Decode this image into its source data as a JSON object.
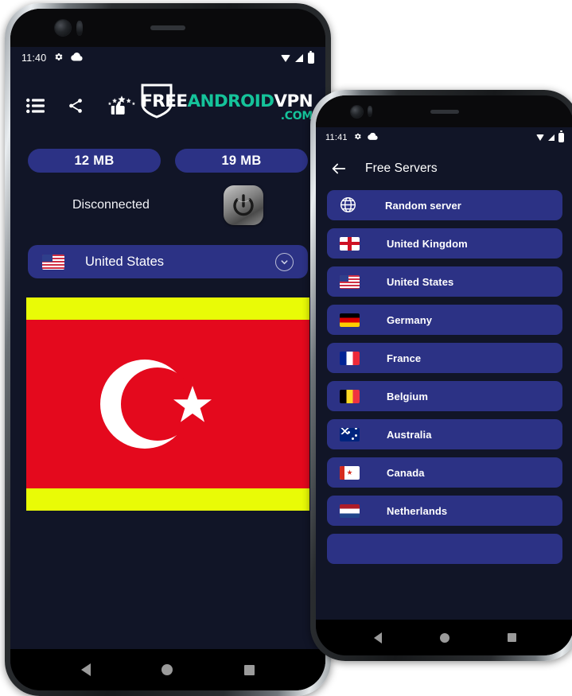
{
  "phone1": {
    "status_bar": {
      "time": "11:40",
      "left_icons": [
        "gear-icon",
        "cloud-icon"
      ],
      "right_icons": [
        "wifi-icon",
        "signal-icon",
        "battery-icon"
      ]
    },
    "toolbar": {
      "icons": [
        "menu-list-icon",
        "share-icon",
        "rate-us-icon"
      ],
      "logo": {
        "part_white_1": "FREE",
        "part_teal": "ANDROID",
        "part_white_2": "VPN",
        "domain": ".COM",
        "teal_color": "#15c39a",
        "shield": "shield-icon"
      }
    },
    "stats": {
      "download_label": "12 MB",
      "upload_label": "19 MB"
    },
    "connection": {
      "status_text": "Disconnected",
      "power_button": "power-icon"
    },
    "selector": {
      "country": "United States",
      "flag": "us",
      "chevron": "chevron-down-icon"
    },
    "ad": {
      "top_bar_color": "#e9fb06",
      "middle_color": "#e4091d",
      "bottom_bar_color": "#e9fb06",
      "emblem": "turkey-crescent-star"
    },
    "nav": {
      "back": "back-triangle-icon",
      "home": "home-circle-icon",
      "recents": "recents-square-icon"
    }
  },
  "phone2": {
    "status_bar": {
      "time": "11:41",
      "left_icons": [
        "gear-icon",
        "cloud-icon"
      ],
      "right_icons": [
        "wifi-icon",
        "signal-icon",
        "battery-icon"
      ]
    },
    "appbar": {
      "back": "back-arrow-icon",
      "title": "Free Servers"
    },
    "servers": [
      {
        "label": "Random server",
        "flag": "globe"
      },
      {
        "label": "United Kingdom",
        "flag": "uk"
      },
      {
        "label": "United States",
        "flag": "us"
      },
      {
        "label": "Germany",
        "flag": "de"
      },
      {
        "label": "France",
        "flag": "fr"
      },
      {
        "label": "Belgium",
        "flag": "be"
      },
      {
        "label": "Australia",
        "flag": "au"
      },
      {
        "label": "Canada",
        "flag": "ca"
      },
      {
        "label": "Netherlands",
        "flag": "nl"
      }
    ],
    "nav": {
      "back": "back-triangle-icon",
      "home": "home-circle-icon",
      "recents": "recents-square-icon"
    }
  },
  "theme": {
    "screen_bg": "#111527",
    "accent_blue": "#2c3285",
    "text_white": "#ffffff"
  }
}
